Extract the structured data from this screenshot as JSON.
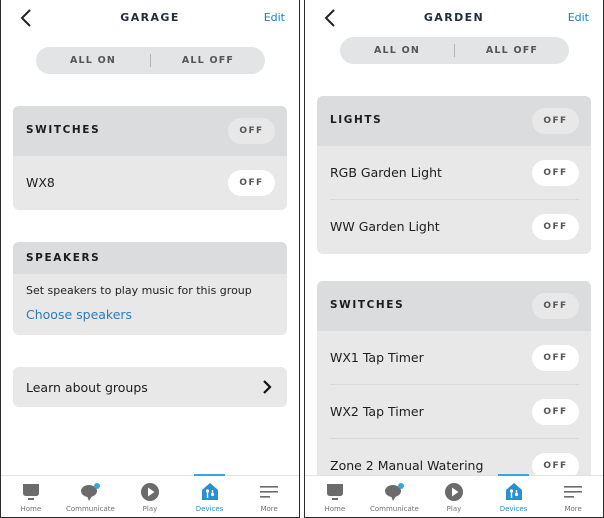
{
  "colors": {
    "accent": "#1f7bbd",
    "active_tab": "#2a8fd0",
    "card_bg": "#e8e8e8",
    "card_header_bg": "#dbdcdd",
    "icon_gray": "#6b6b6b"
  },
  "screens": [
    {
      "header": {
        "back_icon": "chevron-left-icon",
        "title": "GARAGE",
        "edit_label": "Edit"
      },
      "all_toggle": {
        "on_label": "ALL ON",
        "off_label": "ALL OFF"
      },
      "groups": [
        {
          "label": "SWITCHES",
          "state": "OFF",
          "devices": [
            {
              "name": "WX8",
              "state": "OFF"
            }
          ]
        }
      ],
      "speakers": {
        "label": "SPEAKERS",
        "description": "Set speakers to play music for this group",
        "link": "Choose speakers"
      },
      "learn": {
        "label": "Learn about groups",
        "icon": "chevron-right-icon"
      }
    },
    {
      "header": {
        "back_icon": "chevron-left-icon",
        "title": "GARDEN",
        "edit_label": "Edit"
      },
      "all_toggle": {
        "on_label": "ALL ON",
        "off_label": "ALL OFF"
      },
      "groups": [
        {
          "label": "LIGHTS",
          "state": "OFF",
          "devices": [
            {
              "name": "RGB Garden Light",
              "state": "OFF"
            },
            {
              "name": "WW Garden Light",
              "state": "OFF"
            }
          ]
        },
        {
          "label": "SWITCHES",
          "state": "OFF",
          "devices": [
            {
              "name": "WX1 Tap Timer",
              "state": "OFF"
            },
            {
              "name": "WX2 Tap Timer",
              "state": "OFF"
            },
            {
              "name": "Zone 2 Manual Watering",
              "state": "OFF"
            }
          ]
        }
      ]
    }
  ],
  "tabbar": {
    "active": "Devices",
    "tabs": [
      {
        "label": "Home",
        "icon": "home-icon"
      },
      {
        "label": "Communicate",
        "icon": "chat-bubble-icon"
      },
      {
        "label": "Play",
        "icon": "play-icon"
      },
      {
        "label": "Devices",
        "icon": "devices-house-icon"
      },
      {
        "label": "More",
        "icon": "menu-icon"
      }
    ]
  }
}
